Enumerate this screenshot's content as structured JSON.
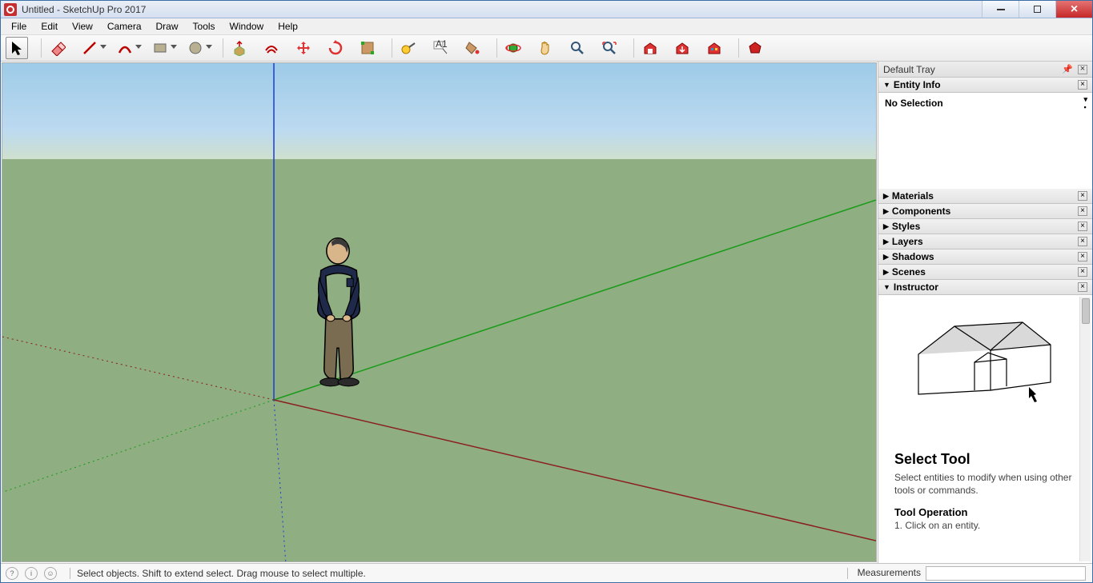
{
  "title": "Untitled - SketchUp Pro 2017",
  "menu": [
    "File",
    "Edit",
    "View",
    "Camera",
    "Draw",
    "Tools",
    "Window",
    "Help"
  ],
  "tray": {
    "header": "Default Tray",
    "entityInfo": {
      "title": "Entity Info",
      "selection": "No Selection"
    },
    "panels": [
      "Materials",
      "Components",
      "Styles",
      "Layers",
      "Shadows",
      "Scenes"
    ],
    "instructor": {
      "title": "Instructor",
      "heading": "Select Tool",
      "desc": "Select entities to modify when using other tools or commands.",
      "opHeading": "Tool Operation",
      "step1": "1. Click on an entity."
    }
  },
  "status": {
    "hint": "Select objects. Shift to extend select. Drag mouse to select multiple.",
    "measLabel": "Measurements"
  },
  "toolbar": [
    {
      "name": "select-tool",
      "active": true
    },
    {
      "name": "eraser-tool",
      "dd": false
    },
    {
      "name": "line-tool",
      "dd": true
    },
    {
      "name": "arc-tool",
      "dd": true
    },
    {
      "name": "rectangle-tool",
      "dd": true
    },
    {
      "name": "circle-tool",
      "dd": true
    },
    {
      "name": "push-pull-tool"
    },
    {
      "name": "offset-tool"
    },
    {
      "name": "move-tool"
    },
    {
      "name": "rotate-tool"
    },
    {
      "name": "scale-tool"
    },
    {
      "name": "tape-measure-tool"
    },
    {
      "name": "text-tool"
    },
    {
      "name": "paint-bucket-tool"
    },
    {
      "name": "orbit-tool"
    },
    {
      "name": "pan-tool"
    },
    {
      "name": "zoom-tool"
    },
    {
      "name": "zoom-extents-tool"
    },
    {
      "name": "warehouse-get"
    },
    {
      "name": "warehouse-share"
    },
    {
      "name": "extension-warehouse"
    },
    {
      "name": "ruby-console"
    }
  ]
}
